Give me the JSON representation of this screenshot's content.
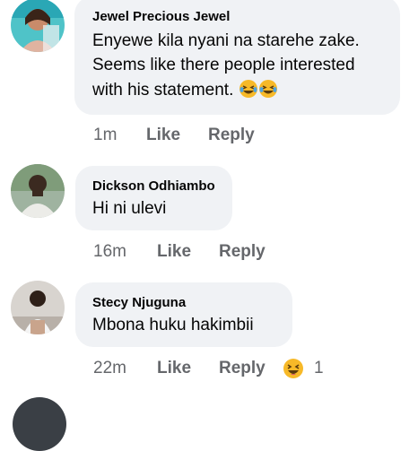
{
  "comments": [
    {
      "author": "Jewel Precious Jewel",
      "lines": [
        "Enyewe kila nyani na starehe zake.",
        "Seems like there people interested",
        "with his statement."
      ],
      "time": "1m",
      "like_label": "Like",
      "reply_label": "Reply",
      "avatar_icon": "user-avatar-icon",
      "inline_emojis": [
        "laughing-tears-icon",
        "laughing-tears-icon"
      ]
    },
    {
      "author": "Dickson Odhiambo",
      "lines": [
        "Hi ni ulevi"
      ],
      "time": "16m",
      "like_label": "Like",
      "reply_label": "Reply",
      "avatar_icon": "user-avatar-icon"
    },
    {
      "author": "Stecy Njuguna",
      "lines": [
        "Mbona huku hakimbii"
      ],
      "time": "22m",
      "like_label": "Like",
      "reply_label": "Reply",
      "avatar_icon": "user-avatar-icon",
      "reaction_icon": "laughing-reaction-icon",
      "reaction_count": "1"
    }
  ],
  "colors": {
    "bubble": "#f0f2f5",
    "meta_text": "#65676b",
    "primary_text": "#050505",
    "reaction_yellow": "#f7b928"
  }
}
